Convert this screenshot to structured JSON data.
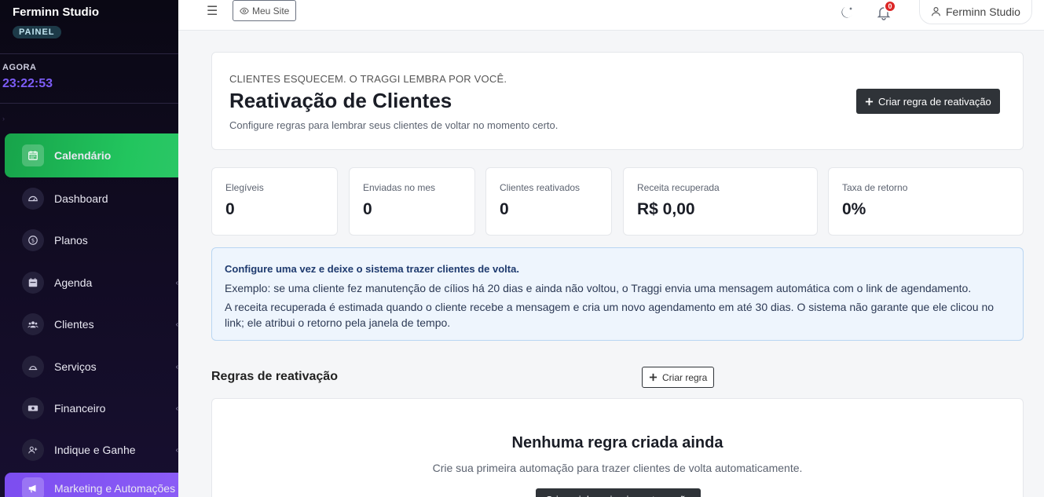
{
  "sidebar": {
    "brand": "Ferminn Studio",
    "badge": "PAINEL",
    "now_label": "AGORA",
    "now_time": "23:22:53",
    "items": [
      {
        "label": "Calendário"
      },
      {
        "label": "Dashboard"
      },
      {
        "label": "Planos"
      },
      {
        "label": "Agenda"
      },
      {
        "label": "Clientes"
      },
      {
        "label": "Serviços"
      },
      {
        "label": "Financeiro"
      },
      {
        "label": "Indique e Ganhe"
      },
      {
        "label": "Marketing e Automações"
      }
    ]
  },
  "topbar": {
    "site_button": "Meu Site",
    "notifications_count": "0",
    "user_label": "Ferminn Studio"
  },
  "hero": {
    "eyebrow": "CLIENTES ESQUECEM. O TRAGGI LEMBRA POR VOCÊ.",
    "title": "Reativação de Clientes",
    "subtitle": "Configure regras para lembrar seus clientes de voltar no momento certo.",
    "create_rule_label": "Criar regra de reativação"
  },
  "stats": [
    {
      "label": "Elegíveis",
      "value": "0"
    },
    {
      "label": "Enviadas no mes",
      "value": "0"
    },
    {
      "label": "Clientes reativados",
      "value": "0"
    },
    {
      "label": "Receita recuperada",
      "value": "R$ 0,00"
    },
    {
      "label": "Taxa de retorno",
      "value": "0%"
    }
  ],
  "info": {
    "title": "Configure uma vez e deixe o sistema trazer clientes de volta.",
    "line1": "Exemplo: se uma cliente fez manutenção de cílios há 20 dias e ainda não voltou, o Traggi envia uma mensagem automática com o link de agendamento.",
    "line2": "A receita recuperada é estimada quando o cliente recebe a mensagem e cria um novo agendamento em até 30 dias. O sistema não garante que ele clicou no link; ele atribui o retorno pela janela de tempo."
  },
  "rules": {
    "section_title": "Regras de reativação",
    "create_label": "Criar regra",
    "empty_title": "Nenhuma regra criada ainda",
    "empty_desc": "Crie sua primeira automação para trazer clientes de volta automaticamente.",
    "empty_button": "Criar minha primeira automação"
  }
}
